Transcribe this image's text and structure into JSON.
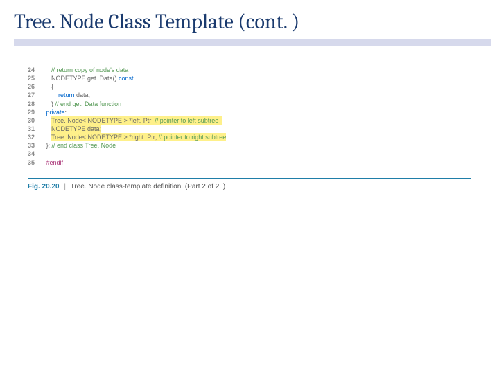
{
  "title": "Tree. Node Class Template (cont. )",
  "figure": {
    "label": "Fig. 20.20",
    "separator": "|",
    "caption": "Tree. Node class-template definition. (Part 2 of 2. )"
  },
  "code": {
    "lines": [
      {
        "n": "24",
        "indent": "    ",
        "segments": [
          {
            "cls": "comment",
            "t": "// return copy of node's data"
          }
        ]
      },
      {
        "n": "25",
        "indent": "    ",
        "segments": [
          {
            "cls": "",
            "t": "NODETYPE get. Data() "
          },
          {
            "cls": "keyword",
            "t": "const"
          }
        ]
      },
      {
        "n": "26",
        "indent": "    ",
        "segments": [
          {
            "cls": "",
            "t": "{"
          }
        ]
      },
      {
        "n": "27",
        "indent": "        ",
        "segments": [
          {
            "cls": "keyword",
            "t": "return"
          },
          {
            "cls": "",
            "t": " data;"
          }
        ]
      },
      {
        "n": "28",
        "indent": "    ",
        "segments": [
          {
            "cls": "",
            "t": "} "
          },
          {
            "cls": "comment",
            "t": "// end get. Data function"
          }
        ]
      },
      {
        "n": "29",
        "indent": " ",
        "segments": [
          {
            "cls": "keyword",
            "t": "private"
          },
          {
            "cls": "",
            "t": ":"
          }
        ]
      },
      {
        "n": "30",
        "indent": "    ",
        "hl": true,
        "segments": [
          {
            "cls": "",
            "t": "Tree. Node< NODETYPE > *left. Ptr; "
          },
          {
            "cls": "comment",
            "t": "// pointer to left subtree"
          }
        ],
        "trail": "  "
      },
      {
        "n": "31",
        "indent": "    ",
        "hl": true,
        "segments": [
          {
            "cls": "",
            "t": "NODETYPE data;"
          }
        ]
      },
      {
        "n": "32",
        "indent": "    ",
        "hl": true,
        "segments": [
          {
            "cls": "",
            "t": "Tree. Node< NODETYPE > *right. Ptr; "
          },
          {
            "cls": "comment",
            "t": "// pointer to right subtree"
          }
        ]
      },
      {
        "n": "33",
        "indent": " ",
        "segments": [
          {
            "cls": "",
            "t": "}; "
          },
          {
            "cls": "comment",
            "t": "// end class Tree. Node"
          }
        ]
      },
      {
        "n": "34",
        "indent": "",
        "segments": []
      },
      {
        "n": "35",
        "indent": " ",
        "segments": [
          {
            "cls": "preproc",
            "t": "#endif"
          }
        ]
      }
    ]
  }
}
